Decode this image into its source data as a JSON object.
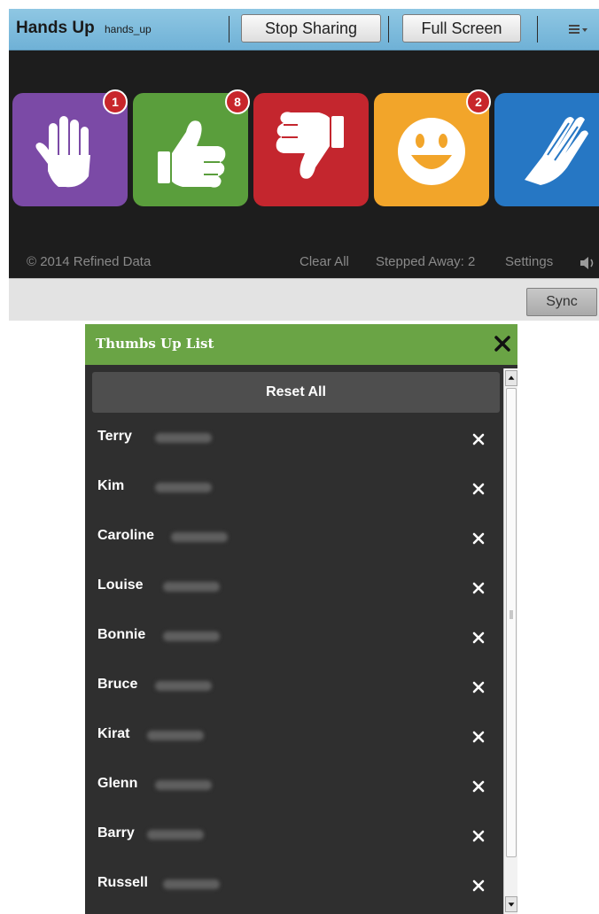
{
  "app": {
    "title": "Hands Up",
    "subtitle": "hands_up",
    "stop_sharing": "Stop Sharing",
    "full_screen": "Full Screen",
    "menu_icon": "menu-lines-icon",
    "colors": {
      "titlebar": "#7dbbe0",
      "stage": "#1d1d1d",
      "badge": "#c8262b"
    }
  },
  "reactions": [
    {
      "name": "hand-raise",
      "icon": "raised-hand-icon",
      "color": "#7b4aa6",
      "count": "1"
    },
    {
      "name": "thumbs-up",
      "icon": "thumbs-up-icon",
      "color": "#5a9e3c",
      "count": "8"
    },
    {
      "name": "thumbs-down",
      "icon": "thumbs-down-icon",
      "color": "#c4262e",
      "count": ""
    },
    {
      "name": "smile",
      "icon": "smiley-icon",
      "color": "#f2a52a",
      "count": "2"
    },
    {
      "name": "applause",
      "icon": "clapping-hands-icon",
      "color": "#2677c4",
      "count": ""
    }
  ],
  "footer": {
    "copyright": "© 2014 Refined Data",
    "clear_all": "Clear All",
    "stepped_away": "Stepped Away: 2",
    "settings": "Settings",
    "speaker_icon": "speaker-icon"
  },
  "sync": "Sync",
  "thumbs_list": {
    "title": "Thumbs Up List",
    "reset_all": "Reset All",
    "header_color": "#6aa445",
    "names": [
      "Terry",
      "Kim",
      "Caroline",
      "Louise",
      "Bonnie",
      "Bruce",
      "Kirat",
      "Glenn",
      "Barry",
      "Russell"
    ],
    "remove_label": "X"
  }
}
